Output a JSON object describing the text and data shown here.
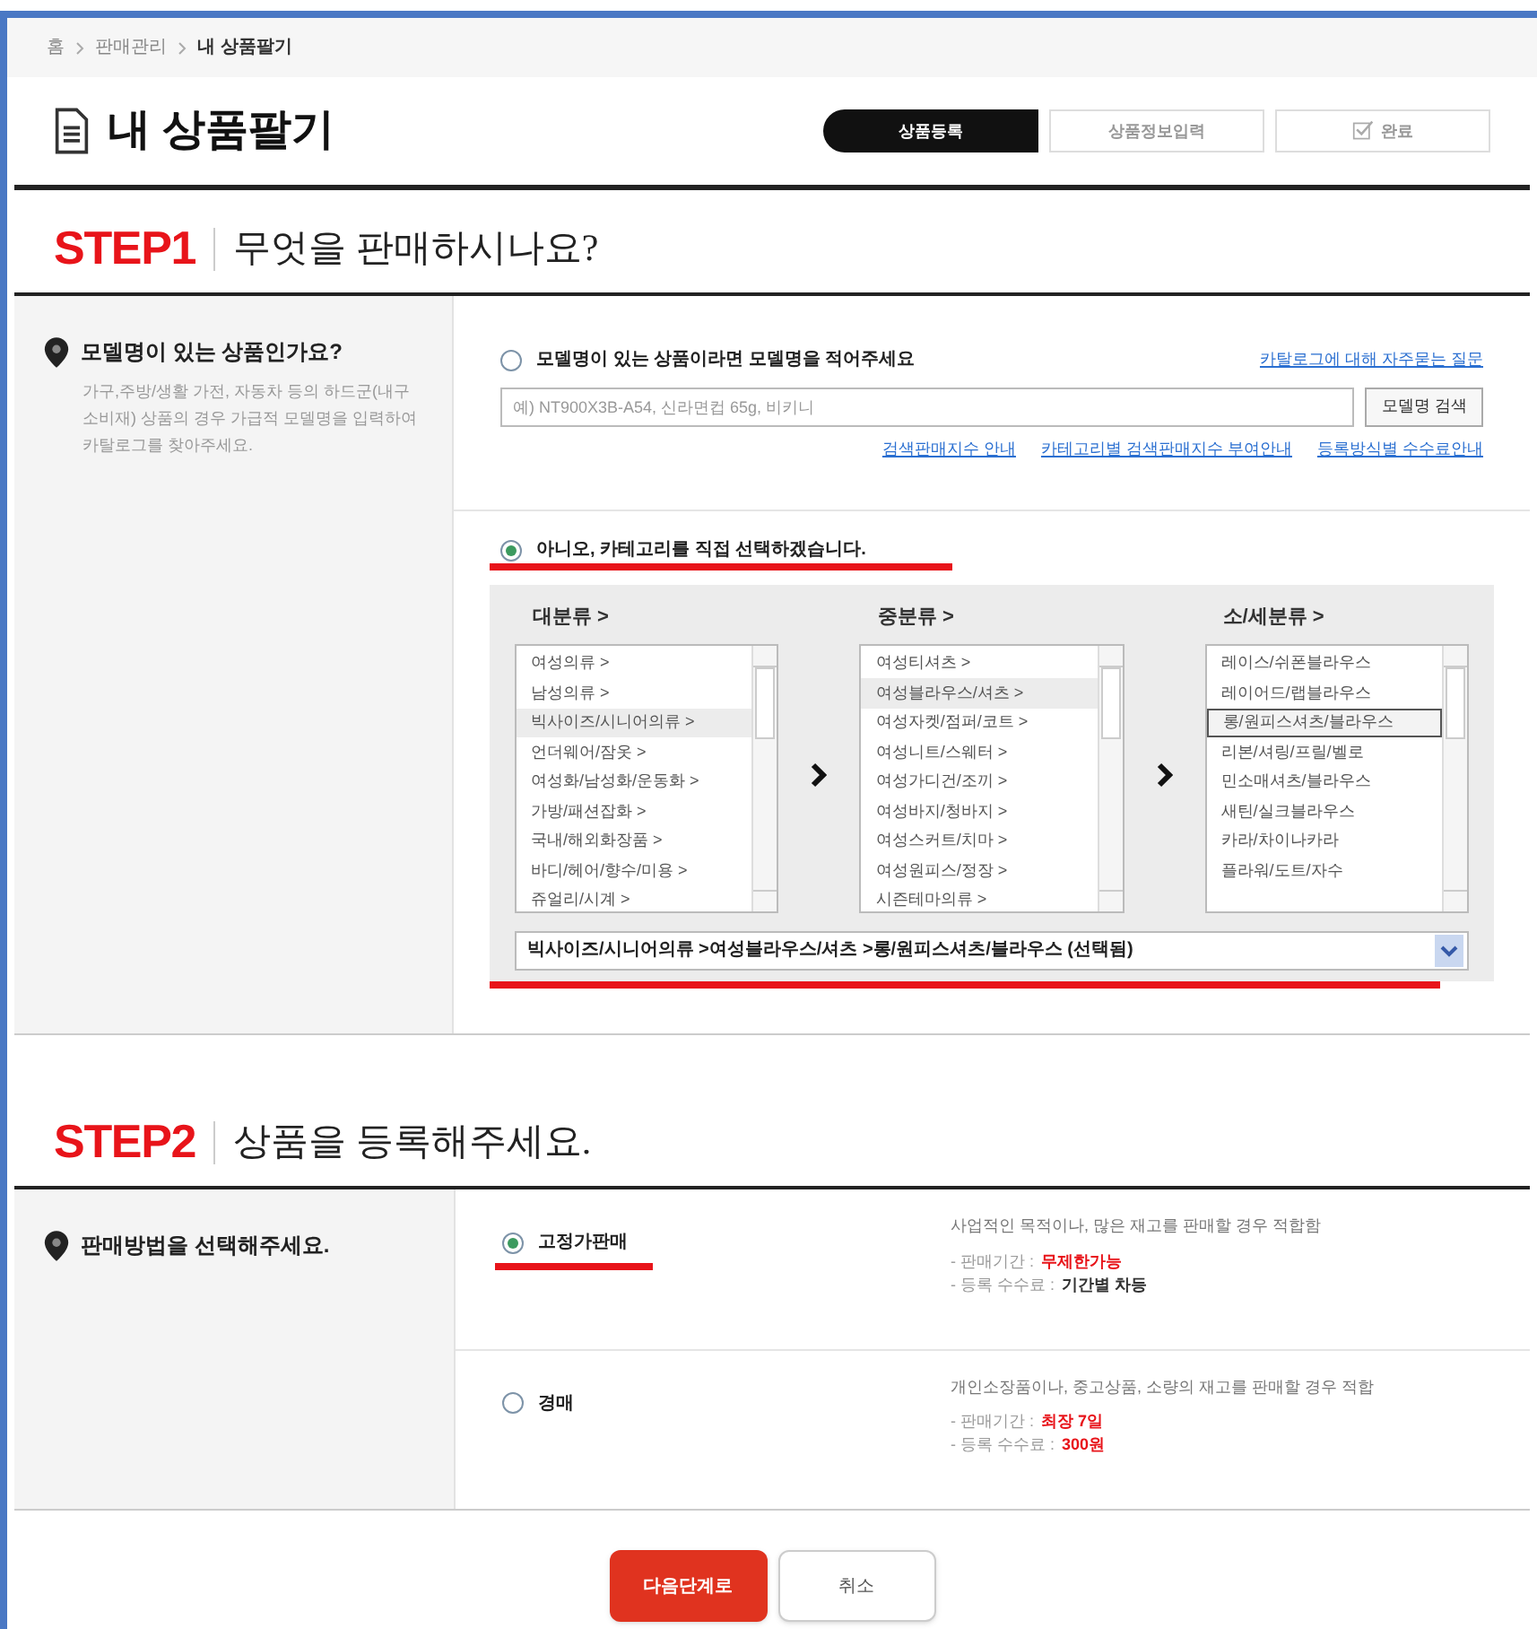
{
  "breadcrumb": [
    "홈",
    "판매관리",
    "내 상품팔기"
  ],
  "page_title": "내 상품팔기",
  "progress_steps": [
    {
      "label": "상품등록",
      "selected": true,
      "kind": "plain"
    },
    {
      "label": "상품정보입력",
      "selected": false,
      "kind": "plain"
    },
    {
      "label": "완료",
      "selected": false,
      "kind": "check"
    }
  ],
  "step1": {
    "number": "STEP1",
    "title": "무엇을 판매하시나요?",
    "side_title": "모델명이 있는 상품인가요?",
    "side_text": "가구,주방/생활 가전, 자동차 등의 하드군(내구소비재) 상품의 경우 가급적 모델명을 입력하여 카탈로그를 찾아주세요.",
    "option_model": {
      "label": "모델명이 있는 상품이라면 모델명을 적어주세요",
      "selected": false,
      "faq_link": "카탈로그에 대해 자주묻는 질문",
      "placeholder": "예) NT900X3B-A54, 신라면컵 65g, 비키니",
      "search_button": "모델명 검색",
      "links": [
        "검색판매지수 안내",
        "카테고리별 검색판매지수 부여안내",
        "등록방식별 수수료안내"
      ]
    },
    "option_category": {
      "label": "아니오, 카테고리를 직접 선택하겠습니다.",
      "selected": true
    },
    "category_columns": [
      {
        "title": "대분류 >",
        "items": [
          {
            "label": "여성의류 >",
            "selected": false
          },
          {
            "label": "남성의류 >",
            "selected": false
          },
          {
            "label": "빅사이즈/시니어의류 >",
            "selected": true
          },
          {
            "label": "언더웨어/잠옷 >",
            "selected": false
          },
          {
            "label": "여성화/남성화/운동화 >",
            "selected": false
          },
          {
            "label": "가방/패션잡화 >",
            "selected": false
          },
          {
            "label": "국내/해외화장품 >",
            "selected": false
          },
          {
            "label": "바디/헤어/향수/미용 >",
            "selected": false
          },
          {
            "label": "쥬얼리/시계 >",
            "selected": false
          }
        ]
      },
      {
        "title": "중분류 >",
        "items": [
          {
            "label": "여성티셔츠 >",
            "selected": false
          },
          {
            "label": "여성블라우스/셔츠 >",
            "selected": true
          },
          {
            "label": "여성자켓/점퍼/코트 >",
            "selected": false
          },
          {
            "label": "여성니트/스웨터 >",
            "selected": false
          },
          {
            "label": "여성가디건/조끼 >",
            "selected": false
          },
          {
            "label": "여성바지/청바지 >",
            "selected": false
          },
          {
            "label": "여성스커트/치마 >",
            "selected": false
          },
          {
            "label": "여성원피스/정장 >",
            "selected": false
          },
          {
            "label": "시즌테마의류 >",
            "selected": false
          }
        ]
      },
      {
        "title": "소/세분류 >",
        "items": [
          {
            "label": "레이스/쉬폰블라우스",
            "selected": false
          },
          {
            "label": "레이어드/랩블라우스",
            "selected": false
          },
          {
            "label": "롱/원피스셔츠/블라우스",
            "selected": true
          },
          {
            "label": "리본/셔링/프릴/벨로",
            "selected": false
          },
          {
            "label": "민소매셔츠/블라우스",
            "selected": false
          },
          {
            "label": "새틴/실크블라우스",
            "selected": false
          },
          {
            "label": "카라/차이나카라",
            "selected": false
          },
          {
            "label": "플라워/도트/자수",
            "selected": false
          }
        ]
      }
    ],
    "selected_path": "빅사이즈/시니어의류 >여성블라우스/셔츠 >롱/원피스셔츠/블라우스 (선택됨)"
  },
  "step2": {
    "number": "STEP2",
    "title": "상품을 등록해주세요.",
    "side_title": "판매방법을 선택해주세요.",
    "methods": [
      {
        "label": "고정가판매",
        "selected": true,
        "description": "사업적인 목적이나, 많은 재고를 판매할 경우 적합함",
        "details": [
          {
            "label": "- 판매기간 :",
            "value": "무제한가능",
            "kind": "red"
          },
          {
            "label": "- 등록 수수료 :",
            "value": "기간별 차등",
            "kind": "dark"
          }
        ]
      },
      {
        "label": "경매",
        "selected": false,
        "description": "개인소장품이나, 중고상품, 소량의 재고를 판매할 경우 적합",
        "details": [
          {
            "label": "- 판매기간 :",
            "value": "최장 7일",
            "kind": "red"
          },
          {
            "label": "- 등록 수수료 :",
            "value": "300원",
            "kind": "red"
          }
        ]
      }
    ]
  },
  "buttons": {
    "next": "다음단계로",
    "cancel": "취소"
  }
}
